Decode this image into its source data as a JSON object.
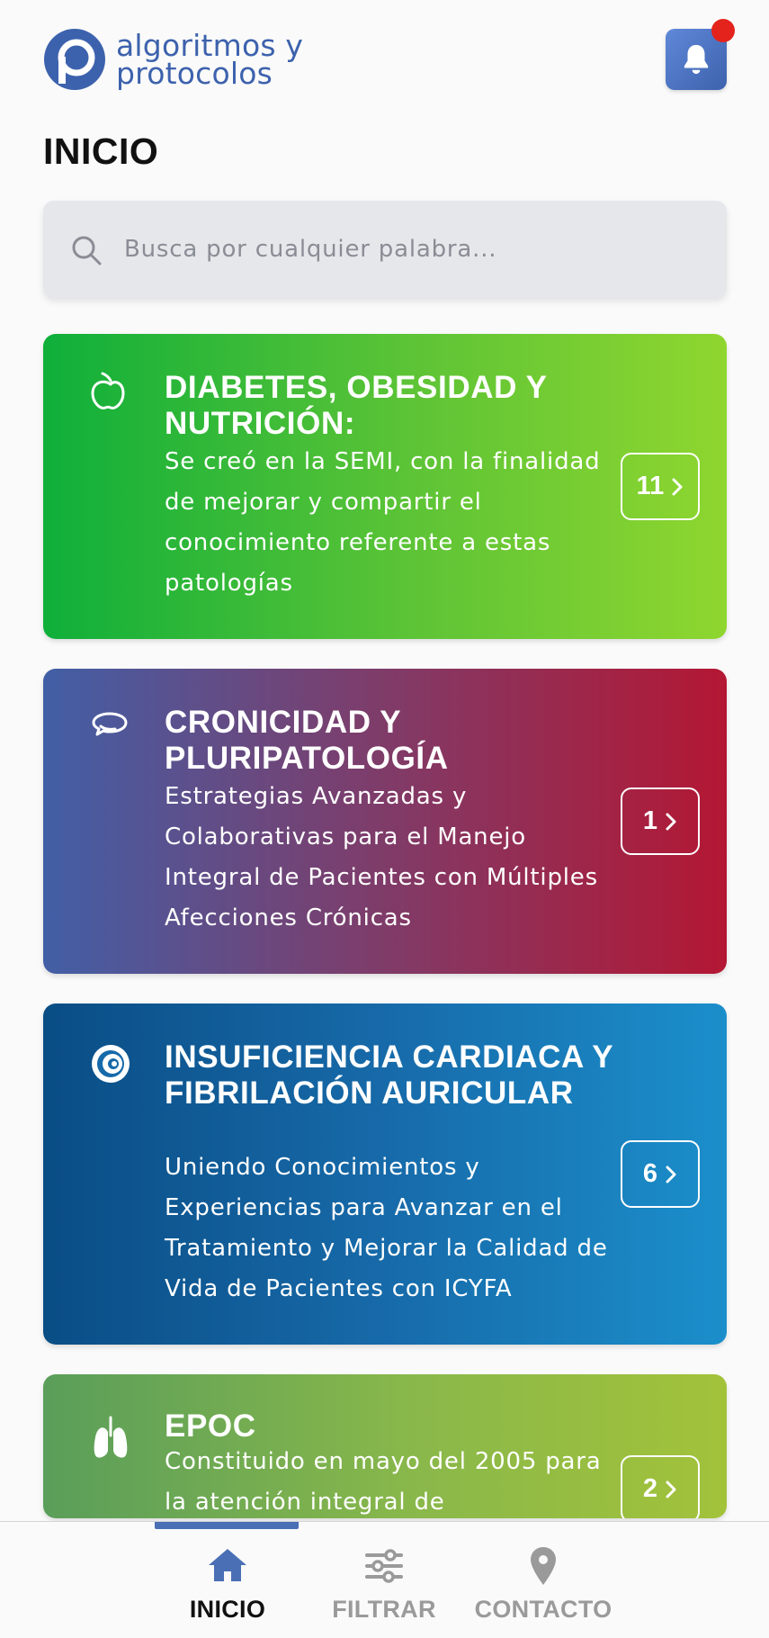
{
  "header": {
    "logo_line1": "algoritmos y",
    "logo_line2": "protocolos",
    "notification_icon": "bell-icon",
    "notification_badge_color": "#e3231c",
    "accent_color": "#3d62ad"
  },
  "page": {
    "title": "INICIO"
  },
  "search": {
    "placeholder": "Busca por cualquier palabra...",
    "value": "",
    "icon": "search-icon"
  },
  "cards": [
    {
      "title": "DIABETES, OBESIDAD Y NUTRICIÓN:",
      "description": "Se creó en la SEMI, con la finalidad de mejorar y compartir el conocimiento referente a estas patologías",
      "count": "11",
      "icon": "apple-icon",
      "colors": [
        "#0faf3a",
        "#8fd62f"
      ]
    },
    {
      "title": "CRONICIDAD Y PLURIPATOLOGÍA",
      "description": "Estrategias Avanzadas y Colaborativas para el Manejo Integral de Pacientes con Múltiples Afecciones Crónicas",
      "count": "1",
      "icon": "chat-bubbles-icon",
      "colors": [
        "#425fa6",
        "#b41733"
      ]
    },
    {
      "title": "INSUFICIENCIA CARDIACA Y FIBRILACIÓN AURICULAR",
      "description": "Uniendo Conocimientos y Experiencias para Avanzar en el Tratamiento y Mejorar la Calidad de Vida de Pacientes con ICYFA",
      "count": "6",
      "icon": "spiral-icon",
      "colors": [
        "#0a4d85",
        "#1b8fcb"
      ]
    },
    {
      "title": "EPOC",
      "description": "Constituido en mayo del 2005 para la atención integral de",
      "count": "2",
      "icon": "lungs-icon",
      "colors": [
        "#5a9e5a",
        "#a2c23a"
      ]
    }
  ],
  "bottom_nav": {
    "items": [
      {
        "label": "INICIO",
        "icon": "home-icon",
        "active": true
      },
      {
        "label": "FILTRAR",
        "icon": "sliders-icon",
        "active": false
      },
      {
        "label": "CONTACTO",
        "icon": "location-pin-icon",
        "active": false
      }
    ],
    "active_color": "#4a6fb5",
    "inactive_color": "#9a9a9a"
  }
}
